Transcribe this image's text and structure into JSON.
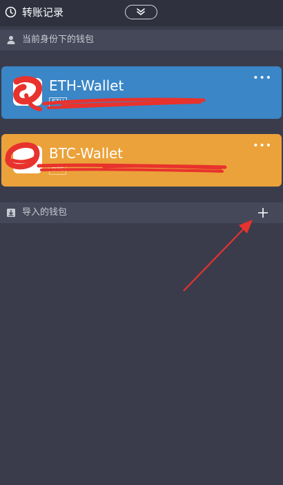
{
  "topbar": {
    "title": "转账记录",
    "icons": {
      "history": "clock-icon",
      "collapse": "double-chevron-down-icon"
    }
  },
  "current_identity_section": {
    "label": "当前身份下的钱包",
    "icon": "person-icon"
  },
  "wallets": [
    {
      "name": "ETH-Wallet",
      "badge": "ETH",
      "color": "#3a86c7",
      "more_icon": "more-dots-icon"
    },
    {
      "name": "BTC-Wallet",
      "badge": "BTC",
      "color": "#eba23a",
      "more_icon": "more-dots-icon"
    }
  ],
  "imported_section": {
    "label": "导入的钱包",
    "icon": "import-icon",
    "add_icon": "plus-icon"
  },
  "colors": {
    "background": "#3a3c4c",
    "section_header": "#454859",
    "annotation_red": "#e8322d"
  }
}
